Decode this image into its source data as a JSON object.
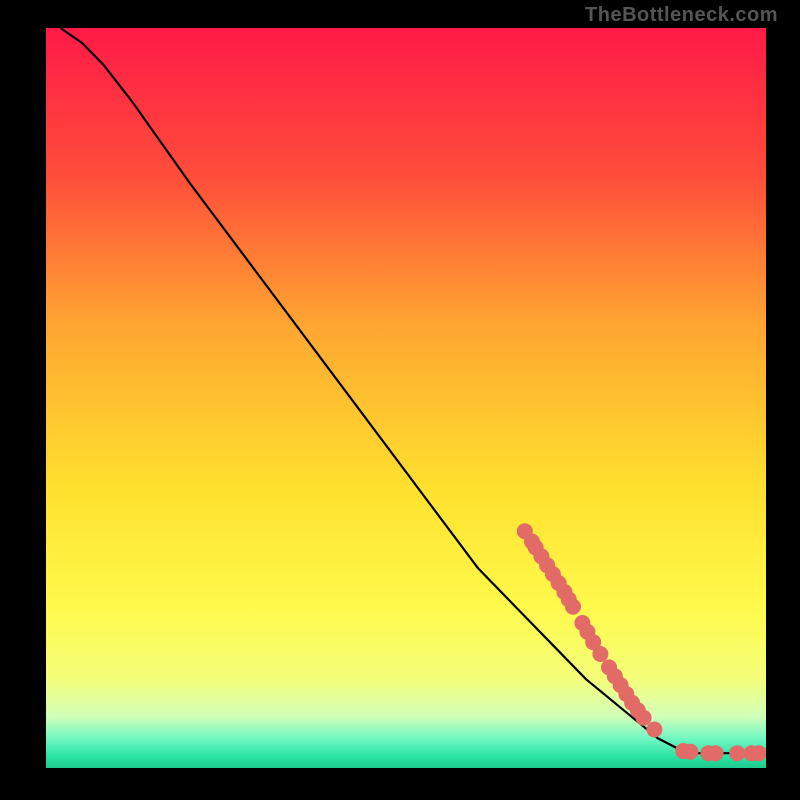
{
  "credit_text": "TheBottleneck.com",
  "chart_data": {
    "type": "line",
    "title": "",
    "xlabel": "",
    "ylabel": "",
    "xlim": [
      0,
      100
    ],
    "ylim": [
      0,
      100
    ],
    "legend": false,
    "grid": false,
    "gradient_stops": [
      {
        "pos": 0.0,
        "color": "#ff1a47"
      },
      {
        "pos": 0.2,
        "color": "#ff4d3a"
      },
      {
        "pos": 0.4,
        "color": "#ffa531"
      },
      {
        "pos": 0.62,
        "color": "#ffe02e"
      },
      {
        "pos": 0.78,
        "color": "#fff94a"
      },
      {
        "pos": 0.88,
        "color": "#f4ff7a"
      },
      {
        "pos": 0.93,
        "color": "#d2ffb8"
      },
      {
        "pos": 0.96,
        "color": "#72f7c3"
      },
      {
        "pos": 0.985,
        "color": "#28e3a2"
      },
      {
        "pos": 1.0,
        "color": "#1fc98f"
      }
    ],
    "curve": [
      {
        "x": 2,
        "y": 100
      },
      {
        "x": 5,
        "y": 98
      },
      {
        "x": 8,
        "y": 95
      },
      {
        "x": 12,
        "y": 90
      },
      {
        "x": 20,
        "y": 79
      },
      {
        "x": 30,
        "y": 66
      },
      {
        "x": 40,
        "y": 53
      },
      {
        "x": 50,
        "y": 40
      },
      {
        "x": 60,
        "y": 27
      },
      {
        "x": 70,
        "y": 17
      },
      {
        "x": 75,
        "y": 12
      },
      {
        "x": 80,
        "y": 8
      },
      {
        "x": 85,
        "y": 4
      },
      {
        "x": 88,
        "y": 2.5
      },
      {
        "x": 90,
        "y": 2
      },
      {
        "x": 100,
        "y": 2
      }
    ],
    "markers": [
      {
        "x": 66.5,
        "y": 32.0
      },
      {
        "x": 67.5,
        "y": 30.6
      },
      {
        "x": 68.0,
        "y": 29.8
      },
      {
        "x": 68.8,
        "y": 28.6
      },
      {
        "x": 69.6,
        "y": 27.4
      },
      {
        "x": 70.4,
        "y": 26.2
      },
      {
        "x": 71.2,
        "y": 25.0
      },
      {
        "x": 72.0,
        "y": 23.8
      },
      {
        "x": 72.6,
        "y": 22.8
      },
      {
        "x": 73.2,
        "y": 21.8
      },
      {
        "x": 74.5,
        "y": 19.6
      },
      {
        "x": 75.2,
        "y": 18.4
      },
      {
        "x": 76.0,
        "y": 17.0
      },
      {
        "x": 77.0,
        "y": 15.4
      },
      {
        "x": 78.2,
        "y": 13.6
      },
      {
        "x": 79.0,
        "y": 12.4
      },
      {
        "x": 79.8,
        "y": 11.2
      },
      {
        "x": 80.6,
        "y": 10.0
      },
      {
        "x": 81.4,
        "y": 8.8
      },
      {
        "x": 82.2,
        "y": 7.8
      },
      {
        "x": 83.0,
        "y": 6.8
      },
      {
        "x": 84.5,
        "y": 5.2
      },
      {
        "x": 88.5,
        "y": 2.3
      },
      {
        "x": 89.5,
        "y": 2.2
      },
      {
        "x": 92.0,
        "y": 2.0
      },
      {
        "x": 93.0,
        "y": 2.0
      },
      {
        "x": 96.0,
        "y": 2.0
      },
      {
        "x": 98.0,
        "y": 2.0
      },
      {
        "x": 99.0,
        "y": 2.0
      }
    ],
    "marker_color": "#e26a67",
    "marker_radius": 8,
    "line_color": "#000000"
  }
}
